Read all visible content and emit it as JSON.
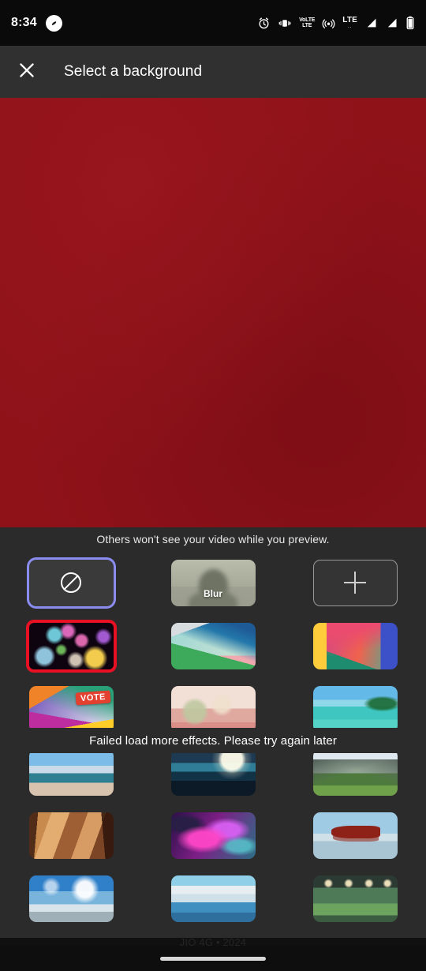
{
  "status_bar": {
    "time": "8:34",
    "left_icons": [
      {
        "name": "shazam-icon",
        "glyph": "S"
      }
    ],
    "right_icons": [
      {
        "name": "alarm-icon",
        "label": "alarm"
      },
      {
        "name": "vibrate-icon",
        "label": "vibrate"
      },
      {
        "name": "volte-icon",
        "top": "VoLTE",
        "bottom": "LTE"
      },
      {
        "name": "hotspot-icon",
        "label": "hotspot"
      },
      {
        "name": "lte-signal-icon",
        "top": "LTE",
        "bottom": ".."
      },
      {
        "name": "signal-bars-1-icon",
        "label": "signal"
      },
      {
        "name": "signal-bars-2-icon",
        "label": "signal"
      },
      {
        "name": "battery-icon",
        "label": "battery"
      }
    ]
  },
  "app_bar": {
    "close_label": "×",
    "title": "Select a background"
  },
  "preview": {
    "background_color": "#8f1219"
  },
  "sheet": {
    "hint": "Others won't see your video while you preview.",
    "toast": "Failed load more effects. Please try again later",
    "selected_border_color": "#8b8cf0",
    "annotation_border_color": "#e81123",
    "effects": [
      {
        "id": "none",
        "label": "",
        "kind": "none",
        "selected": true,
        "annotated": false
      },
      {
        "id": "blur",
        "label": "Blur",
        "kind": "blur",
        "selected": false,
        "annotated": false
      },
      {
        "id": "add",
        "label": "+",
        "kind": "add",
        "selected": false,
        "annotated": false
      },
      {
        "id": "bokeh",
        "label": "",
        "kind": "image",
        "art": "bg-bokeh",
        "selected": false,
        "annotated": true
      },
      {
        "id": "abstract1",
        "label": "",
        "kind": "image",
        "art": "bg-abstract1",
        "selected": false,
        "annotated": false
      },
      {
        "id": "abstract2",
        "label": "",
        "kind": "image",
        "art": "bg-abstract2",
        "selected": false,
        "annotated": false
      },
      {
        "id": "vote",
        "label": "VOTE",
        "kind": "image",
        "art": "bg-vote",
        "selected": false,
        "annotated": false
      },
      {
        "id": "surreal",
        "label": "",
        "kind": "image",
        "art": "bg-surreal",
        "selected": false,
        "annotated": false
      },
      {
        "id": "beach",
        "label": "",
        "kind": "image",
        "art": "bg-beach",
        "selected": false,
        "annotated": false
      },
      {
        "id": "shore",
        "label": "",
        "kind": "image",
        "art": "bg-shore",
        "selected": false,
        "annotated": false
      },
      {
        "id": "night",
        "label": "",
        "kind": "image",
        "art": "bg-night",
        "selected": false,
        "annotated": false
      },
      {
        "id": "mountain",
        "label": "",
        "kind": "image",
        "art": "bg-mountain",
        "selected": false,
        "annotated": false
      },
      {
        "id": "canyon",
        "label": "",
        "kind": "image",
        "art": "bg-canyon",
        "selected": false,
        "annotated": false
      },
      {
        "id": "nebula",
        "label": "",
        "kind": "image",
        "art": "bg-nebula",
        "selected": false,
        "annotated": false
      },
      {
        "id": "plane",
        "label": "",
        "kind": "image",
        "art": "bg-plane",
        "selected": false,
        "annotated": false
      },
      {
        "id": "sky",
        "label": "",
        "kind": "image",
        "art": "bg-sky",
        "selected": false,
        "annotated": false
      },
      {
        "id": "ocean",
        "label": "",
        "kind": "image",
        "art": "bg-ocean",
        "selected": false,
        "annotated": false
      },
      {
        "id": "room",
        "label": "",
        "kind": "image",
        "art": "bg-room",
        "selected": false,
        "annotated": false
      }
    ]
  },
  "footer": {
    "note": "JIO 4G • 2024"
  },
  "nav_bar": {
    "pill": "home-gesture-pill"
  }
}
